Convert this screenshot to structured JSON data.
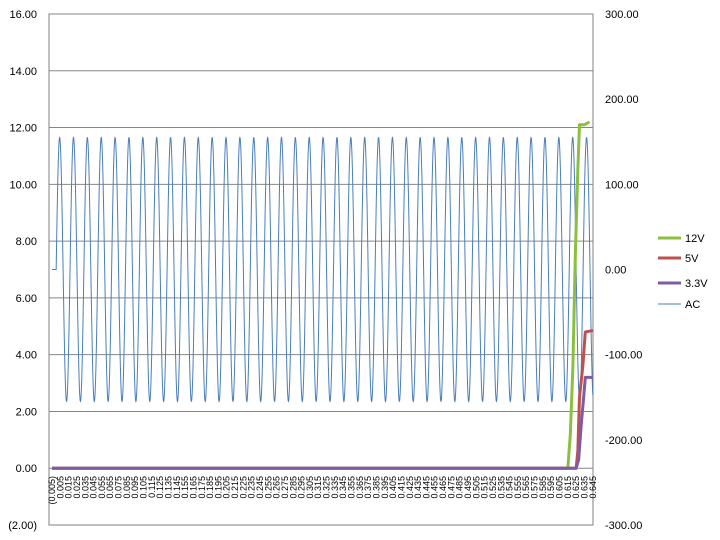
{
  "chart_data": {
    "type": "line",
    "title": "",
    "xlabel": "",
    "ylabel": "",
    "grid": true,
    "legend_position": "right",
    "primary_axis": {
      "min": -2,
      "max": 16,
      "ticks": [
        -2,
        0,
        2,
        4,
        6,
        8,
        10,
        12,
        14,
        16
      ],
      "tick_labels": [
        "(2.00)",
        "0.00",
        "2.00",
        "4.00",
        "6.00",
        "8.00",
        "10.00",
        "12.00",
        "14.00",
        "16.00"
      ]
    },
    "secondary_axis": {
      "min": -300,
      "max": 300,
      "ticks": [
        -300,
        -200,
        -100,
        0,
        100,
        200,
        300
      ],
      "tick_labels": [
        "-300.00",
        "-200.00",
        "-100.00",
        "0.00",
        "100.00",
        "200.00",
        "300.00"
      ]
    },
    "x_axis": {
      "min": -0.005,
      "max": 0.65,
      "tick_labels": [
        "(0.005)",
        "0.005",
        "0.015",
        "0.025",
        "0.035",
        "0.045",
        "0.055",
        "0.065",
        "0.075",
        "0.085",
        "0.095",
        "0.105",
        "0.115",
        "0.125",
        "0.135",
        "0.145",
        "0.155",
        "0.165",
        "0.175",
        "0.185",
        "0.195",
        "0.205",
        "0.215",
        "0.225",
        "0.235",
        "0.245",
        "0.255",
        "0.265",
        "0.275",
        "0.285",
        "0.295",
        "0.305",
        "0.315",
        "0.325",
        "0.335",
        "0.345",
        "0.355",
        "0.365",
        "0.375",
        "0.385",
        "0.395",
        "0.405",
        "0.415",
        "0.425",
        "0.435",
        "0.445",
        "0.455",
        "0.465",
        "0.475",
        "0.485",
        "0.495",
        "0.505",
        "0.515",
        "0.525",
        "0.535",
        "0.545",
        "0.555",
        "0.565",
        "0.575",
        "0.585",
        "0.595",
        "0.605",
        "0.615",
        "0.625",
        "0.635",
        "0.645"
      ]
    },
    "series": [
      {
        "name": "12V",
        "axis": "primary",
        "color": "#8CBF3F",
        "points": [
          [
            -0.005,
            0.0
          ],
          [
            0.615,
            0.0
          ],
          [
            0.618,
            1.2
          ],
          [
            0.621,
            3.5
          ],
          [
            0.624,
            7.5
          ],
          [
            0.627,
            10.5
          ],
          [
            0.629,
            12.1
          ],
          [
            0.635,
            12.1
          ],
          [
            0.641,
            12.2
          ]
        ]
      },
      {
        "name": "5V",
        "axis": "primary",
        "color": "#C0504D",
        "points": [
          [
            -0.005,
            0.0
          ],
          [
            0.625,
            0.0
          ],
          [
            0.627,
            0.6
          ],
          [
            0.629,
            2.5
          ],
          [
            0.633,
            3.6
          ],
          [
            0.636,
            4.8
          ],
          [
            0.645,
            4.85
          ]
        ]
      },
      {
        "name": "3.3V",
        "axis": "primary",
        "color": "#7F5BA6",
        "points": [
          [
            -0.005,
            0.0
          ],
          [
            0.625,
            0.0
          ],
          [
            0.628,
            0.3
          ],
          [
            0.631,
            1.5
          ],
          [
            0.634,
            2.5
          ],
          [
            0.636,
            3.2
          ],
          [
            0.645,
            3.2
          ]
        ]
      },
      {
        "name": "AC",
        "axis": "secondary",
        "color": "#4A7EBB",
        "constant_until": 0.0,
        "constant_value": 0,
        "amplitude": 155,
        "frequency_hz": 60,
        "x_end": 0.645
      }
    ]
  }
}
